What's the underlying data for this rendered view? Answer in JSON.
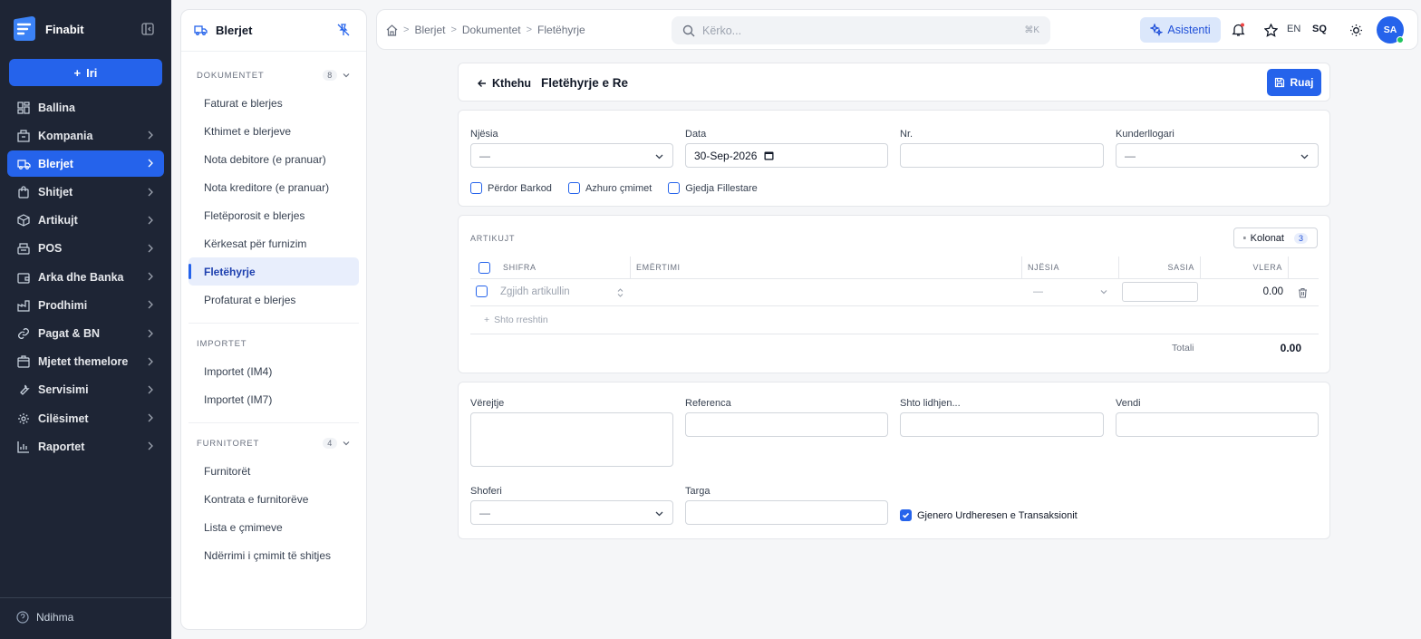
{
  "sidebar": {
    "brand": "Finabit",
    "new_label": "Iri",
    "items": [
      {
        "label": "Ballina",
        "icon": "dashboard-icon"
      },
      {
        "label": "Kompania",
        "icon": "building-icon"
      },
      {
        "label": "Blerjet",
        "icon": "truck-icon"
      },
      {
        "label": "Shitjet",
        "icon": "shopping-bag-icon"
      },
      {
        "label": "Artikujt",
        "icon": "box-icon"
      },
      {
        "label": "POS",
        "icon": "register-icon"
      },
      {
        "label": "Arka dhe Banka",
        "icon": "wallet-icon"
      },
      {
        "label": "Prodhimi",
        "icon": "factory-icon"
      },
      {
        "label": "Pagat & BN",
        "icon": "link-icon"
      },
      {
        "label": "Mjetet themelore",
        "icon": "package-icon"
      },
      {
        "label": "Servisimi",
        "icon": "wrench-icon"
      },
      {
        "label": "Cilësimet",
        "icon": "gear-icon"
      },
      {
        "label": "Raportet",
        "icon": "bar-chart-icon"
      }
    ],
    "help_label": "Ndihma"
  },
  "subnav": {
    "title": "Blerjet",
    "sections": [
      {
        "title": "DOKUMENTET",
        "count": "8",
        "items": [
          "Faturat e blerjes",
          "Kthimet e blerjeve",
          "Nota debitore (e pranuar)",
          "Nota kreditore (e pranuar)",
          "Fletëporosit e blerjes",
          "Kërkesat për furnizim",
          "Fletëhyrje",
          "Profaturat e blerjes"
        ]
      },
      {
        "title": "IMPORTET",
        "items": [
          "Importet (IM4)",
          "Importet (IM7)"
        ]
      },
      {
        "title": "FURNITORET",
        "count": "4",
        "items": [
          "Furnitorët",
          "Kontrata e furnitorëve",
          "Lista e çmimeve",
          "Ndërrimi i çmimit të shitjes"
        ]
      }
    ]
  },
  "topbar": {
    "breadcrumb": [
      "Blerjet",
      "Dokumentet",
      "Fletëhyrje"
    ],
    "search_placeholder": "Kërko...",
    "search_shortcut": "⌘K",
    "assistant_label": "Asistenti",
    "lang_en": "EN",
    "lang_sq": "SQ",
    "avatar_initials": "SA"
  },
  "page": {
    "back_label": "Kthehu",
    "title": "Fletëhyrje e Re",
    "save_label": "Ruaj"
  },
  "form": {
    "njesia_label": "Njësia",
    "njesia_value": "—",
    "data_label": "Data",
    "data_value": "30-Sep-2026",
    "nr_label": "Nr.",
    "kunderllogari_label": "Kunderllogari",
    "kunderllogari_value": "—",
    "checkboxes": [
      "Përdor Barkod",
      "Azhuro çmimet",
      "Gjedja Fillestare"
    ]
  },
  "items_table": {
    "title": "ARTIKUJT",
    "columns_button": "Kolonat",
    "columns_count": "3",
    "headers": [
      "SHIFRA",
      "EMËRTIMI",
      "NJËSIA",
      "SASIA",
      "VLERA"
    ],
    "row": {
      "placeholder": "Zgjidh artikullin",
      "unit": "—",
      "value": "0.00"
    },
    "add_row": "Shto rreshtin",
    "total_label": "Totali",
    "total_value": "0.00"
  },
  "footer_form": {
    "verejtje_label": "Vërejtje",
    "referenca_label": "Referenca",
    "lidhje_label": "Shto lidhjen...",
    "vendi_label": "Vendi",
    "shoferi_label": "Shoferi",
    "shoferi_value": "—",
    "targa_label": "Targa",
    "generate_label": "Gjenero Urdheresen e Transaksionit"
  },
  "colors": {
    "sidebar_bg": "#1e2535",
    "accent": "#2563eb",
    "notification": "#ef4444"
  }
}
